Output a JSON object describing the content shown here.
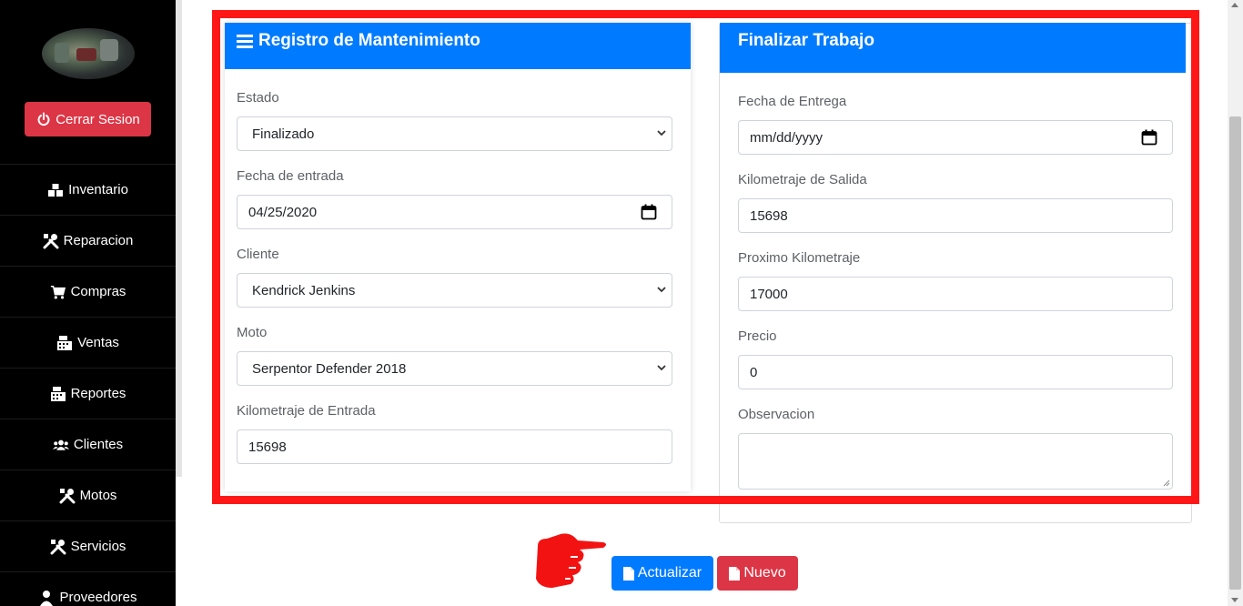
{
  "sidebar": {
    "logout_label": "Cerrar Sesion",
    "items": [
      {
        "label": "Inventario",
        "icon": "boxes-icon"
      },
      {
        "label": "Reparacion",
        "icon": "tools-icon"
      },
      {
        "label": "Compras",
        "icon": "cart-icon"
      },
      {
        "label": "Ventas",
        "icon": "cash-register-icon"
      },
      {
        "label": "Reportes",
        "icon": "cash-register-icon"
      },
      {
        "label": "Clientes",
        "icon": "users-icon"
      },
      {
        "label": "Motos",
        "icon": "tools-icon"
      },
      {
        "label": "Servicios",
        "icon": "tools-icon"
      },
      {
        "label": "Proveedores",
        "icon": "user-icon"
      }
    ]
  },
  "registro": {
    "title": "Registro de Mantenimiento",
    "estado_label": "Estado",
    "estado_value": "Finalizado",
    "fecha_entrada_label": "Fecha de entrada",
    "fecha_entrada_value": "04/25/2020",
    "cliente_label": "Cliente",
    "cliente_value": "Kendrick Jenkins",
    "moto_label": "Moto",
    "moto_value": "Serpentor Defender 2018",
    "km_entrada_label": "Kilometraje de Entrada",
    "km_entrada_value": "15698"
  },
  "finalizar": {
    "title": "Finalizar Trabajo",
    "fecha_entrega_label": "Fecha de Entrega",
    "fecha_entrega_placeholder": "mm/dd/yyyy",
    "km_salida_label": "Kilometraje de Salida",
    "km_salida_value": "15698",
    "prox_km_label": "Proximo Kilometraje",
    "prox_km_value": "17000",
    "precio_label": "Precio",
    "precio_value": "0",
    "observacion_label": "Observacion",
    "observacion_value": ""
  },
  "actions": {
    "actualizar_label": "Actualizar",
    "nuevo_label": "Nuevo"
  },
  "colors": {
    "primary": "#007bff",
    "danger": "#dc3545",
    "highlight": "#ff1717"
  }
}
